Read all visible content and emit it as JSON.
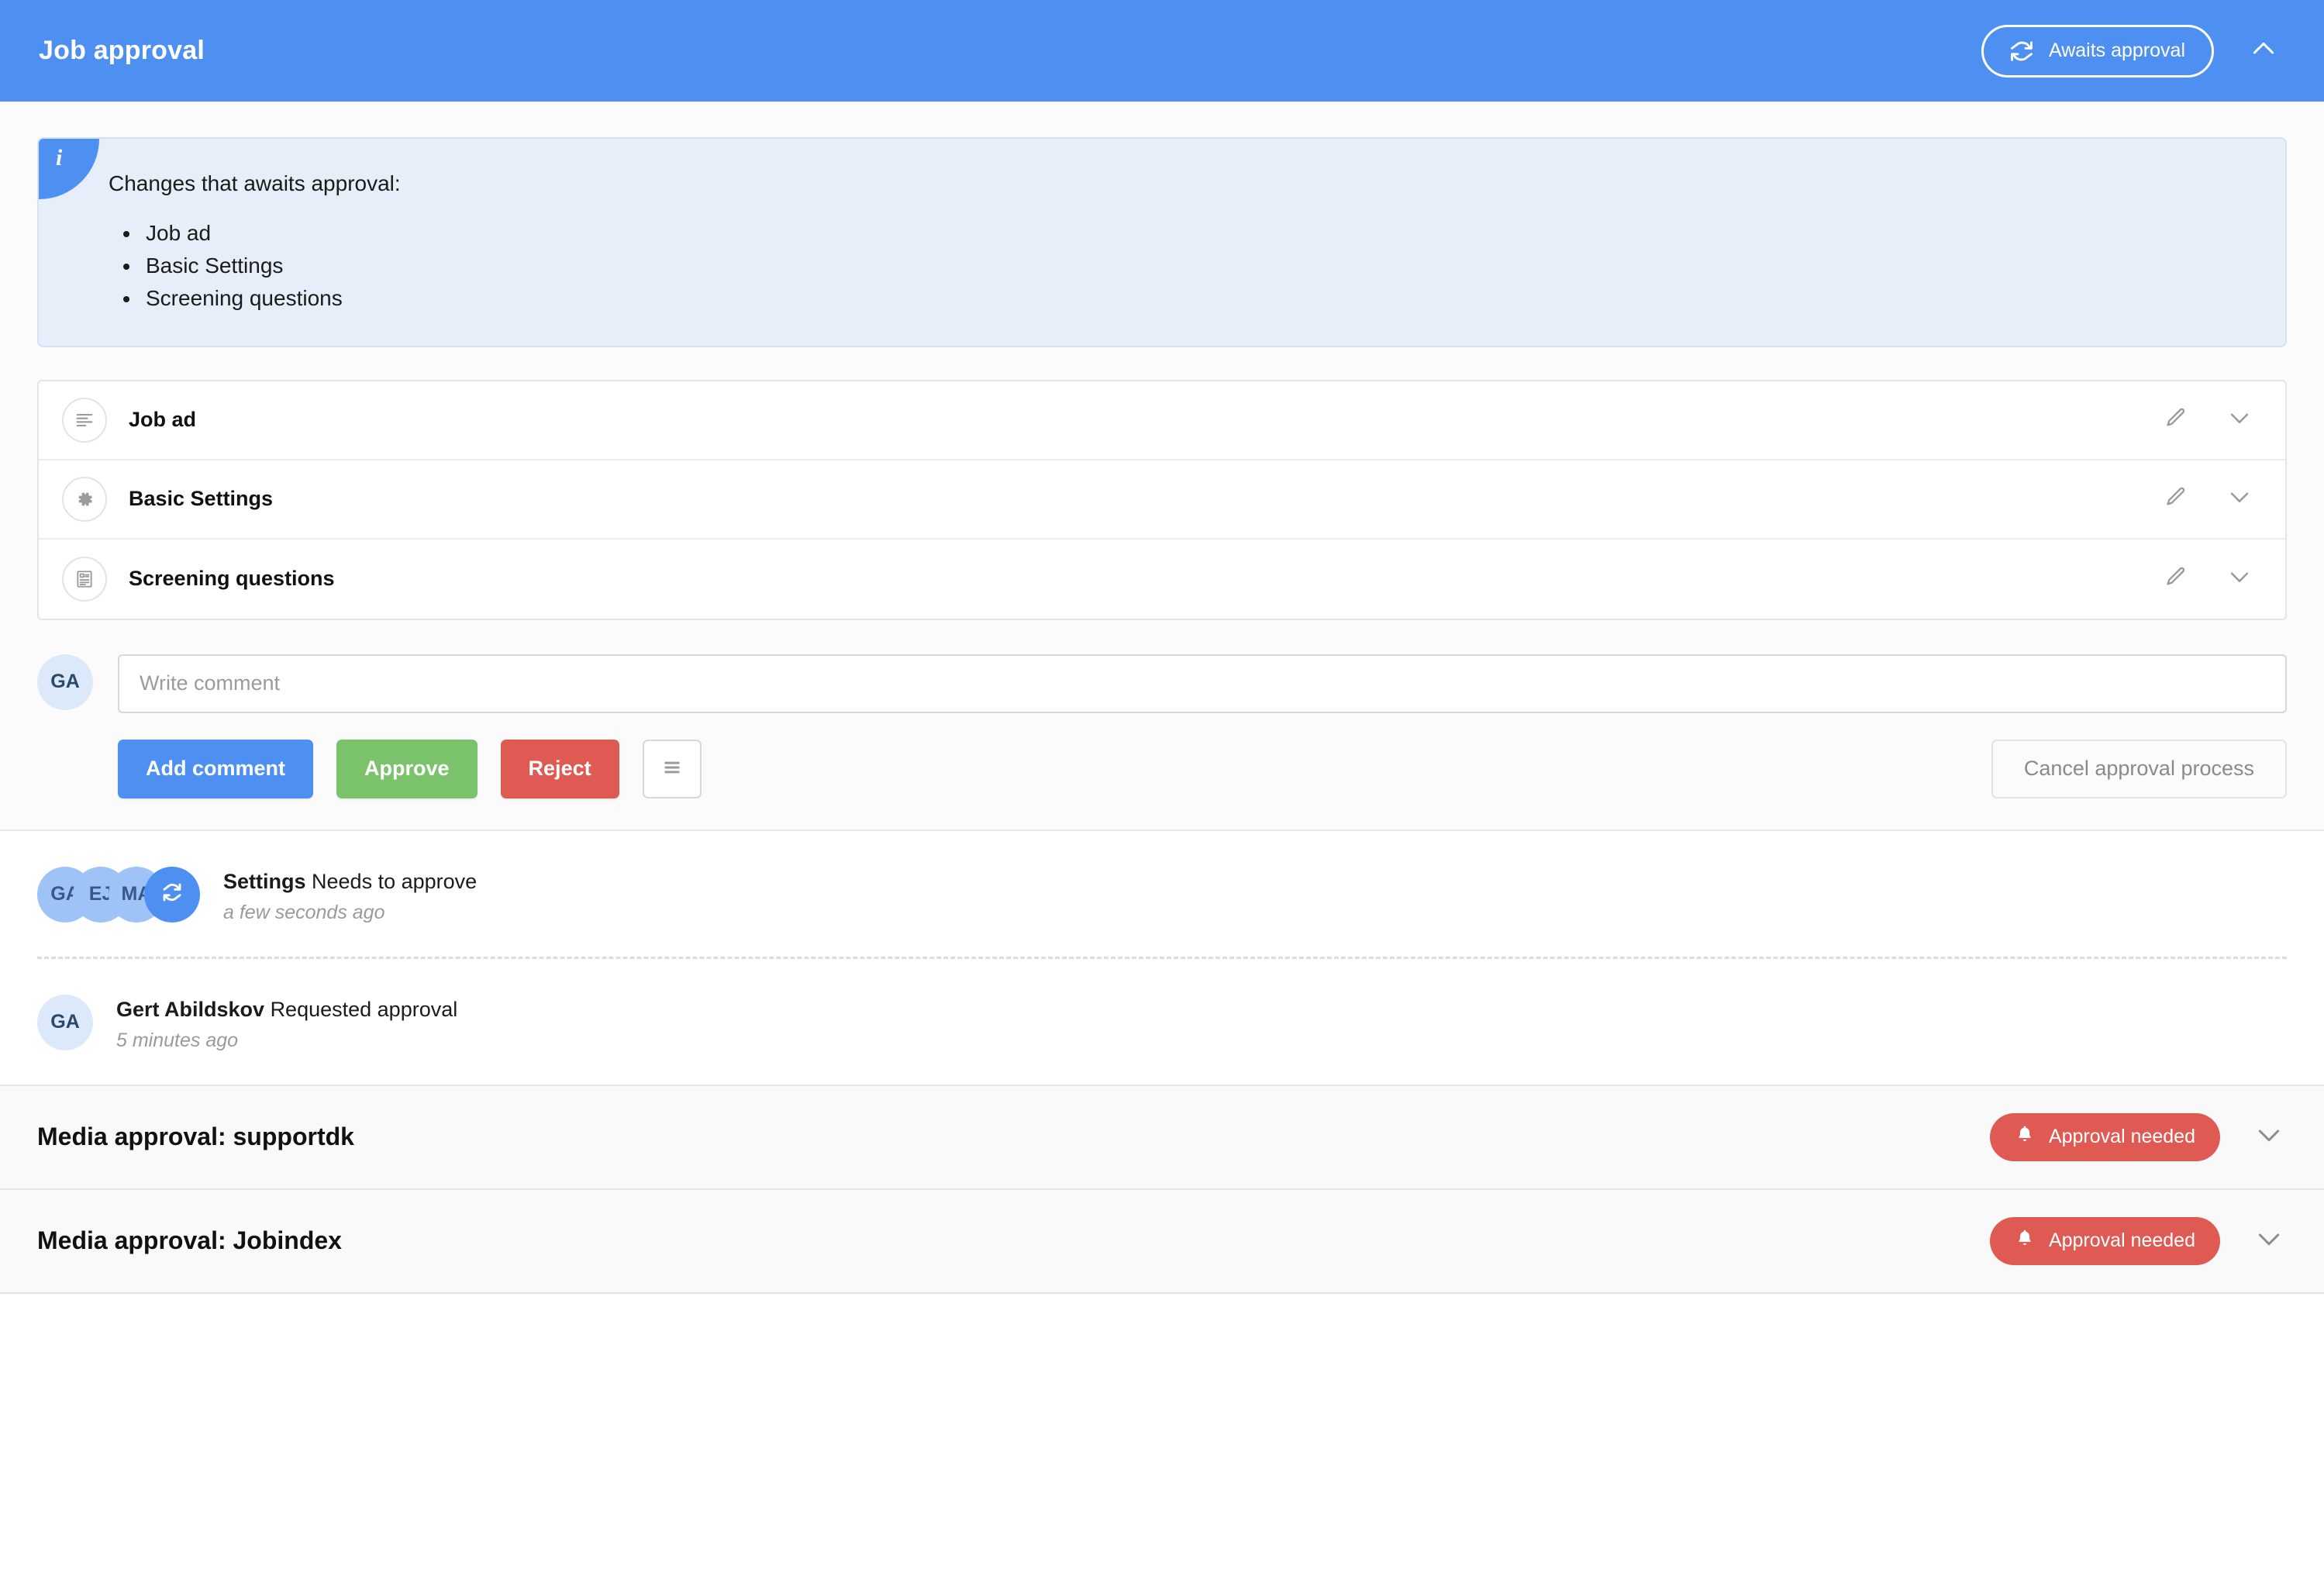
{
  "header": {
    "title": "Job approval",
    "status_label": "Awaits approval",
    "status_icon": "sync-icon",
    "collapse_icon": "chevron-up-icon"
  },
  "info_banner": {
    "icon": "info-icon",
    "icon_char": "i",
    "heading": "Changes that awaits approval:",
    "items": [
      "Job ad",
      "Basic Settings",
      "Screening questions"
    ]
  },
  "accordion": {
    "rows": [
      {
        "label": "Job ad",
        "icon": "align-left-icon",
        "edit_icon": "pencil-icon",
        "expand_icon": "chevron-down-icon"
      },
      {
        "label": "Basic Settings",
        "icon": "gear-icon",
        "edit_icon": "pencil-icon",
        "expand_icon": "chevron-down-icon"
      },
      {
        "label": "Screening questions",
        "icon": "document-list-icon",
        "edit_icon": "pencil-icon",
        "expand_icon": "chevron-down-icon"
      }
    ]
  },
  "comment": {
    "avatar_initials": "GA",
    "placeholder": "Write comment",
    "value": ""
  },
  "actions": {
    "add_comment": "Add comment",
    "approve": "Approve",
    "reject": "Reject",
    "more_icon": "hamburger-icon",
    "cancel": "Cancel approval process"
  },
  "feed": [
    {
      "avatars": [
        "GA",
        "EJ",
        "MA"
      ],
      "action_icon": "sync-icon",
      "subject": "Settings",
      "action": "Needs to approve",
      "time": "a few seconds ago"
    },
    {
      "avatars": [
        "GA"
      ],
      "subject": "Gert Abildskov",
      "action": "Requested approval",
      "time": "5 minutes ago"
    }
  ],
  "media_sections": [
    {
      "title": "Media approval: supportdk",
      "badge": "Approval needed",
      "badge_icon": "bell-icon",
      "expand_icon": "chevron-down-icon"
    },
    {
      "title": "Media approval: Jobindex",
      "badge": "Approval needed",
      "badge_icon": "bell-icon",
      "expand_icon": "chevron-down-icon"
    }
  ],
  "colors": {
    "brand_blue": "#4e90f2",
    "green": "#7ac36a",
    "red": "#e05a54",
    "info_bg": "#e6eef9"
  }
}
